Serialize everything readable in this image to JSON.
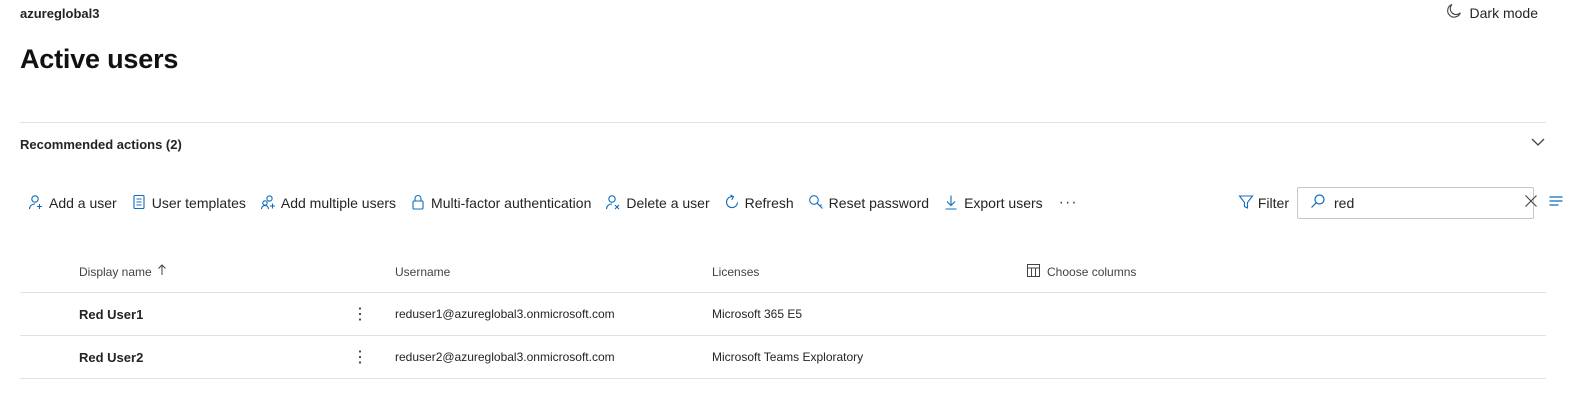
{
  "header": {
    "org_name": "azureglobal3",
    "dark_mode_label": "Dark mode",
    "page_title": "Active users"
  },
  "recommended": {
    "label": "Recommended actions (2)"
  },
  "toolbar": {
    "items": [
      {
        "label": "Add a user",
        "icon": "add-user-icon"
      },
      {
        "label": "User templates",
        "icon": "document-icon"
      },
      {
        "label": "Add multiple users",
        "icon": "add-people-icon"
      },
      {
        "label": "Multi-factor authentication",
        "icon": "lock-icon"
      },
      {
        "label": "Delete a user",
        "icon": "remove-user-icon"
      },
      {
        "label": "Refresh",
        "icon": "refresh-icon"
      },
      {
        "label": "Reset password",
        "icon": "key-search-icon"
      },
      {
        "label": "Export users",
        "icon": "download-icon"
      }
    ],
    "more_label": "···",
    "filter_label": "Filter",
    "search_value": "red"
  },
  "table": {
    "columns": {
      "display_name": "Display name",
      "username": "Username",
      "licenses": "Licenses",
      "choose_columns": "Choose columns"
    },
    "rows": [
      {
        "display_name": "Red User1",
        "username": "reduser1@azureglobal3.onmicrosoft.com",
        "licenses": "Microsoft 365 E5"
      },
      {
        "display_name": "Red User2",
        "username": "reduser2@azureglobal3.onmicrosoft.com",
        "licenses": "Microsoft Teams Exploratory"
      }
    ]
  },
  "colors": {
    "accent": "#0f6cbd",
    "text": "#242424",
    "divider": "#e1e1e1"
  }
}
